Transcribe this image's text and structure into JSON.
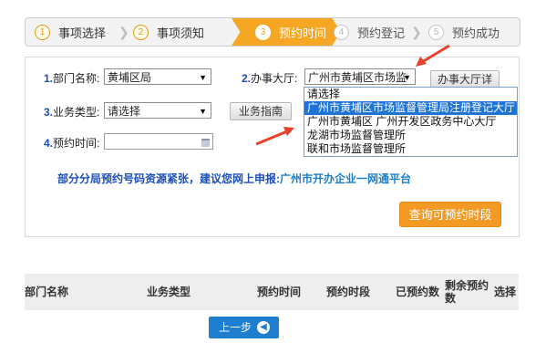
{
  "steps": [
    {
      "num": "1",
      "label": "事项选择",
      "state": "done"
    },
    {
      "num": "2",
      "label": "事项须知",
      "state": "done"
    },
    {
      "num": "3",
      "label": "预约时间",
      "state": "active"
    },
    {
      "num": "4",
      "label": "预约登记",
      "state": "todo"
    },
    {
      "num": "5",
      "label": "预约成功",
      "state": "todo"
    }
  ],
  "form": {
    "dept": {
      "num": "1.",
      "label": "部门名称:",
      "value": "黄埔区局"
    },
    "hall": {
      "num": "2.",
      "label": "办事大厅:",
      "value": "广州市黄埔区市场监",
      "detail_button": "办事大厅详"
    },
    "biz": {
      "num": "3.",
      "label": "业务类型:",
      "value": "请选择",
      "guide_button": "业务指南"
    },
    "date": {
      "num": "4.",
      "label": "预约时间:",
      "value": ""
    },
    "hall_options": [
      "请选择",
      "广州市黄埔区市场监督管理局注册登记大厅",
      "广州市黄埔区 广州开发区政务中心大厅",
      "龙湖市场监督管理所",
      "联和市场监督管理所"
    ],
    "hall_highlighted_index": 1,
    "notice": "部分分局预约号码资源紧张，建议您网上申报:",
    "notice_link": "广州市开办企业一网通平台",
    "query_button": "查询可预约时段"
  },
  "table": {
    "headers": [
      "部门名称",
      "业务类型",
      "预约时间",
      "预约时段",
      "已预约数",
      "剩余预约数",
      "选择"
    ]
  },
  "back_button": "上一步",
  "colors": {
    "accent_orange": "#f39a24",
    "link_blue": "#1d4fb8",
    "button_blue": "#1e7fd0",
    "annotation_red": "#e8412c"
  }
}
